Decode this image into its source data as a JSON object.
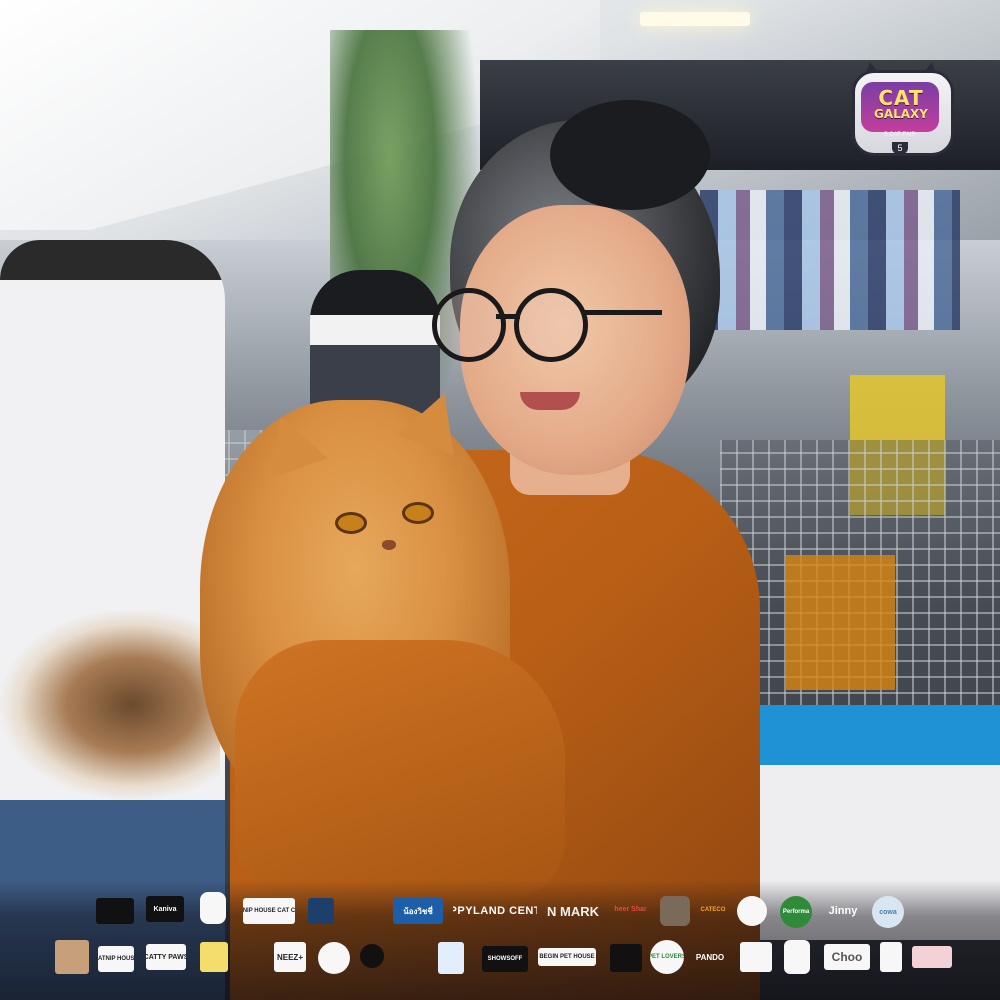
{
  "logo": {
    "line1": "CAT",
    "line2": "GALAXY",
    "subtitle": "5 CAT FAIR",
    "edition": "5"
  },
  "sponsors": {
    "row1": [
      "",
      "Kaniva",
      "",
      "CATNIP HOUSE CAT CAFE",
      "",
      "",
      "น้องวิชชี่",
      "HAPPYLAND CENTER",
      "N MARK",
      "Cheer Share",
      "",
      "CATECO",
      "",
      "Performa",
      "Jinny",
      "cowa"
    ],
    "row2": [
      "",
      "CATNIP HOUSE",
      "CATTY PAWS",
      "",
      "",
      "NEEZ+",
      "",
      "",
      "",
      "",
      "SHOWSOFF",
      "BEGIN PET HOUSE",
      "",
      "PET LOVERS",
      "PANDO",
      "",
      "",
      "Choo",
      "",
      ""
    ]
  },
  "colors": {
    "shirt": "#c76a1c",
    "cat_fur": "#d98f41",
    "tray": "#1e92d4",
    "logo_purple": "#7a3ea5"
  }
}
